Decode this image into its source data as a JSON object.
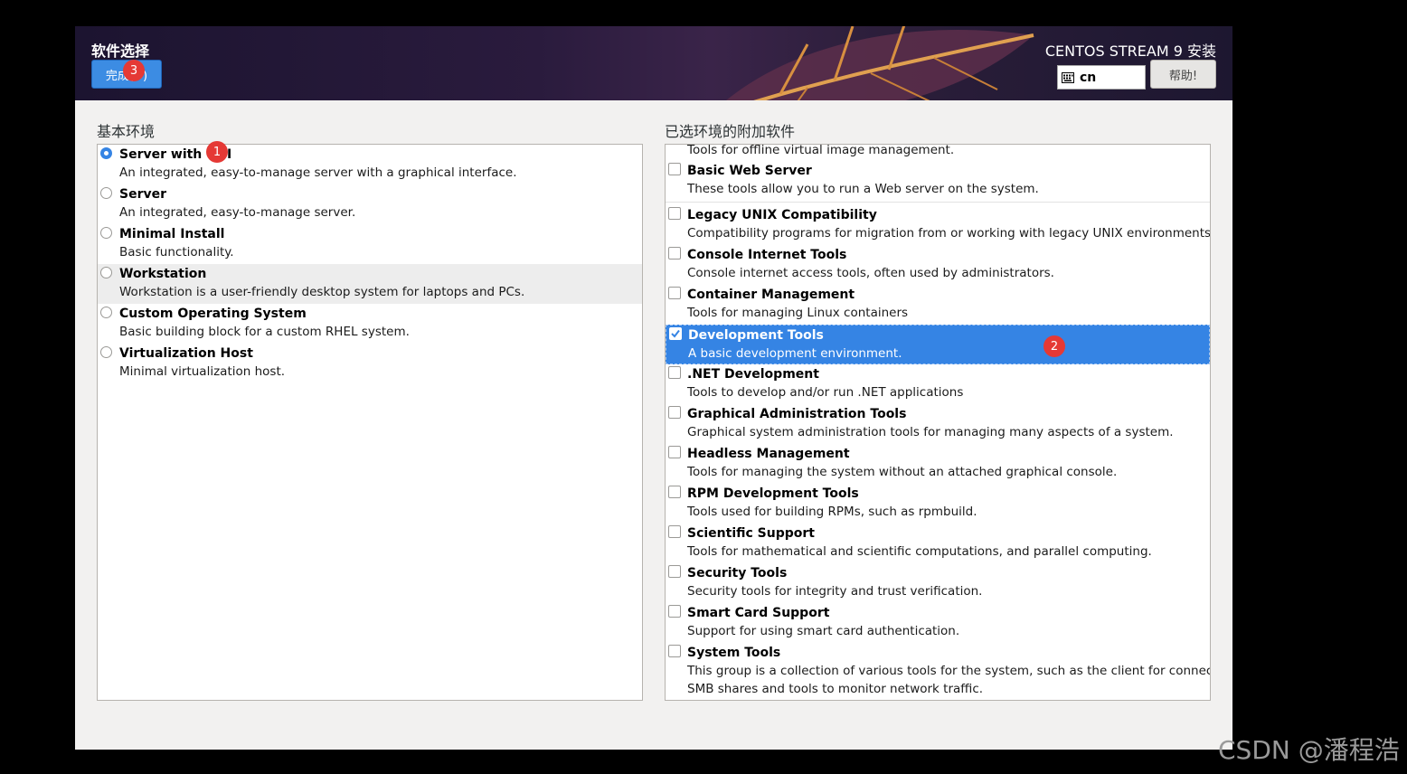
{
  "header": {
    "spoke_title": "软件选择",
    "done_button": "完成(D)",
    "product_title": "CENTOS STREAM 9 安装",
    "keyboard_layout": "cn",
    "help_button": "帮助!"
  },
  "environments": {
    "heading": "基本环境",
    "items": [
      {
        "title": "Server with GUI",
        "desc": "An integrated, easy-to-manage server with a graphical interface.",
        "selected": true
      },
      {
        "title": "Server",
        "desc": "An integrated, easy-to-manage server.",
        "selected": false
      },
      {
        "title": "Minimal Install",
        "desc": "Basic functionality.",
        "selected": false
      },
      {
        "title": "Workstation",
        "desc": "Workstation is a user-friendly desktop system for laptops and PCs.",
        "selected": false
      },
      {
        "title": "Custom Operating System",
        "desc": "Basic building block for a custom RHEL system.",
        "selected": false
      },
      {
        "title": "Virtualization Host",
        "desc": "Minimal virtualization host.",
        "selected": false
      }
    ]
  },
  "addons": {
    "heading": "已选环境的附加软件",
    "partial_top_desc": "Tools for offline virtual image management.",
    "items": [
      {
        "title": "Basic Web Server",
        "desc": "These tools allow you to run a Web server on the system.",
        "checked": false
      },
      {
        "title": "Legacy UNIX Compatibility",
        "desc": "Compatibility programs for migration from or working with legacy UNIX environments.",
        "checked": false
      },
      {
        "title": "Console Internet Tools",
        "desc": "Console internet access tools, often used by administrators.",
        "checked": false
      },
      {
        "title": "Container Management",
        "desc": "Tools for managing Linux containers",
        "checked": false
      },
      {
        "title": "Development Tools",
        "desc": "A basic development environment.",
        "checked": true
      },
      {
        "title": ".NET Development",
        "desc": "Tools to develop and/or run .NET applications",
        "checked": false
      },
      {
        "title": "Graphical Administration Tools",
        "desc": "Graphical system administration tools for managing many aspects of a system.",
        "checked": false
      },
      {
        "title": "Headless Management",
        "desc": "Tools for managing the system without an attached graphical console.",
        "checked": false
      },
      {
        "title": "RPM Development Tools",
        "desc": "Tools used for building RPMs, such as rpmbuild.",
        "checked": false
      },
      {
        "title": "Scientific Support",
        "desc": "Tools for mathematical and scientific computations, and parallel computing.",
        "checked": false
      },
      {
        "title": "Security Tools",
        "desc": "Security tools for integrity and trust verification.",
        "checked": false
      },
      {
        "title": "Smart Card Support",
        "desc": "Support for using smart card authentication.",
        "checked": false
      },
      {
        "title": "System Tools",
        "desc": "This group is a collection of various tools for the system, such as the client for connecting to",
        "desc2": "SMB shares and tools to monitor network traffic.",
        "checked": false
      }
    ]
  },
  "annotations": {
    "badge1": "1",
    "badge2": "2",
    "badge3": "3"
  },
  "watermark": "CSDN @潘程浩",
  "colors": {
    "accent": "#3584e4",
    "badge": "#e53935"
  }
}
